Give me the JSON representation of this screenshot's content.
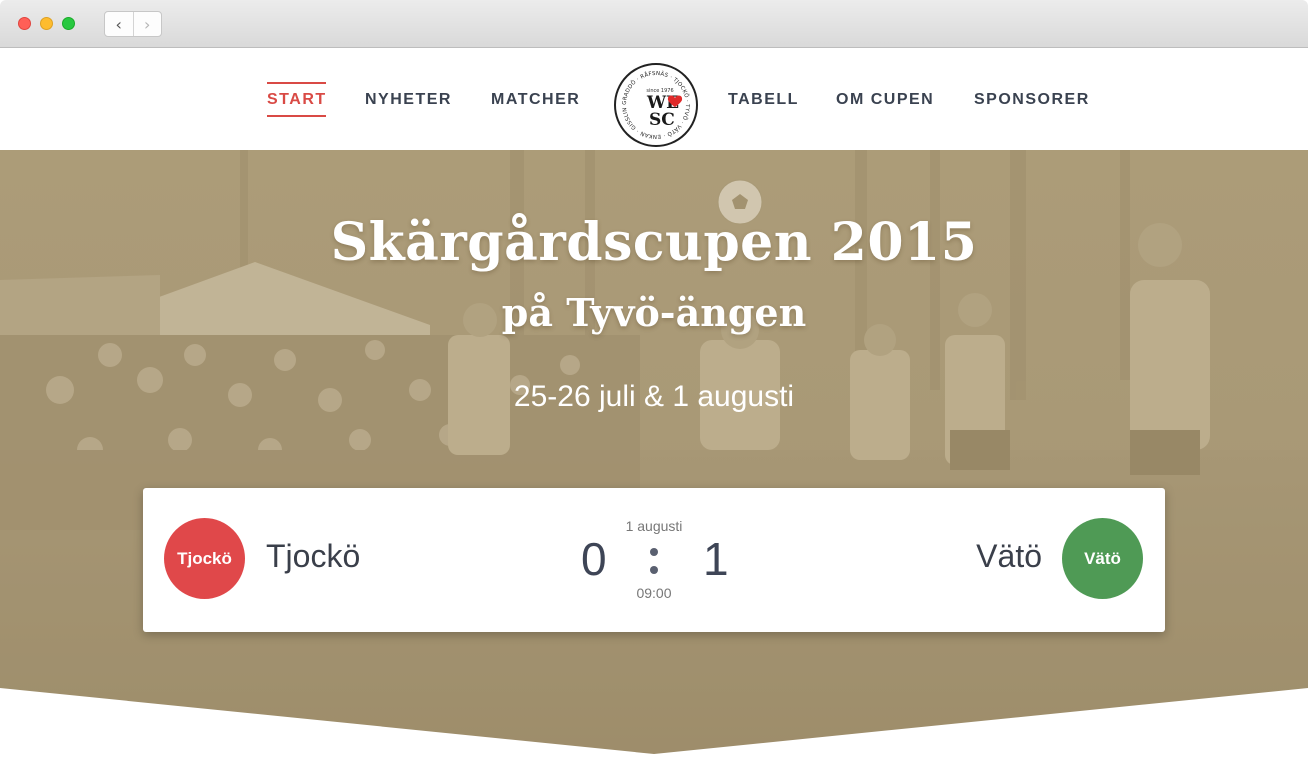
{
  "browser": {
    "back_glyph": "‹",
    "forward_glyph": "›"
  },
  "nav": {
    "items": [
      {
        "label": "START",
        "active": true
      },
      {
        "label": "NYHETER"
      },
      {
        "label": "MATCHER"
      },
      {
        "label": "TABELL"
      },
      {
        "label": "OM CUPEN"
      },
      {
        "label": "SPONSORER"
      }
    ],
    "logo": {
      "line1": "WE",
      "line2": "SC",
      "ring_text": "GRADDÖ · RÅFSNÄS · TJOCKÖ · TYVÖ · VÄTÖ · ENKAN · GISSLINGÖ ·",
      "since": "since 1976"
    }
  },
  "hero": {
    "title": "Skärgårdscupen 2015",
    "subtitle": "på Tyvö-ängen",
    "dates": "25-26 juli & 1 augusti"
  },
  "match": {
    "date": "1 augusti",
    "time": "09:00",
    "home": {
      "name": "Tjockö",
      "badge": "Tjockö",
      "score": "0",
      "color": "#e0484a"
    },
    "away": {
      "name": "Vätö",
      "badge": "Vätö",
      "score": "1",
      "color": "#4f9a55"
    }
  },
  "colors": {
    "accent": "#d94a45",
    "hero_tint": "#a89874",
    "nav_text": "#3a4250"
  }
}
